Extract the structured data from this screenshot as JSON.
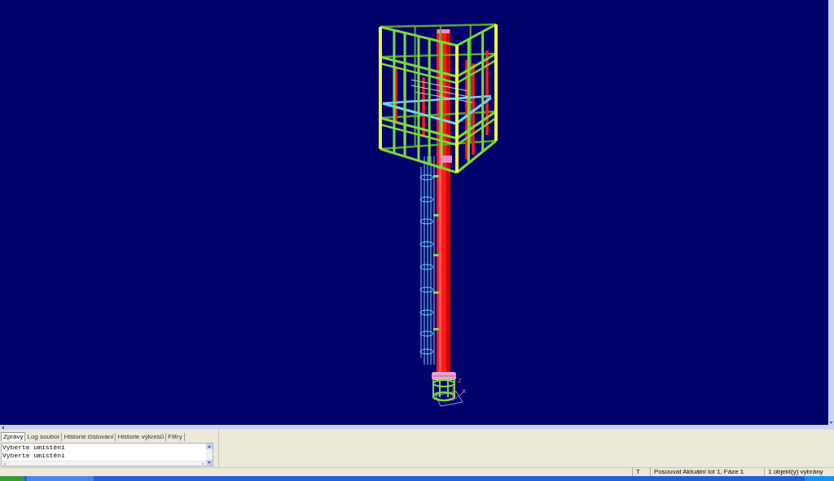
{
  "viewport": {
    "axis_labels": [
      "Z",
      "X"
    ]
  },
  "command_panel": {
    "tabs": [
      {
        "label": "Zprávy",
        "selected": true
      },
      {
        "label": "Log soubor",
        "selected": false
      },
      {
        "label": "Historie číslování",
        "selected": false
      },
      {
        "label": "Historie výkresů",
        "selected": false
      },
      {
        "label": "Filtry",
        "selected": false
      }
    ],
    "messages": [
      "Vyberte umístění",
      "Vyberte umístění"
    ]
  },
  "status_bar": {
    "panes": [
      "T",
      "Posouvat Aktuální lot 1, Fáze 1",
      "1 objekt(y) vybrány"
    ]
  }
}
